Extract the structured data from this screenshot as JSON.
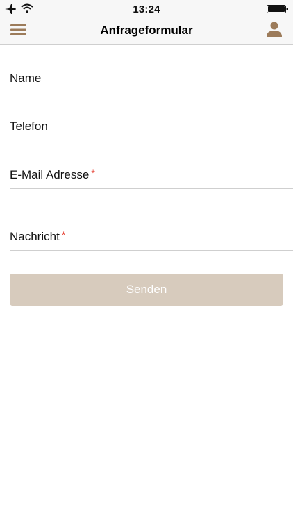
{
  "status_bar": {
    "time": "13:24",
    "icons": [
      "airplane-icon",
      "wifi-icon",
      "battery-icon"
    ]
  },
  "nav_bar": {
    "title": "Anfrageformular",
    "menu_icon": "hamburger-menu-icon",
    "profile_icon": "user-icon"
  },
  "form": {
    "fields": [
      {
        "label": "Name",
        "required": false,
        "value": ""
      },
      {
        "label": "Telefon",
        "required": false,
        "value": ""
      },
      {
        "label": "E-Mail Adresse",
        "required": true,
        "value": ""
      },
      {
        "label": "Nachricht",
        "required": true,
        "value": ""
      }
    ],
    "required_marker": "*",
    "submit_label": "Senden"
  },
  "colors": {
    "accent_brown": "#9c7b5a",
    "button_bg": "#d7cbbd",
    "required_red": "#e5392b",
    "bar_bg": "#f7f7f7"
  }
}
